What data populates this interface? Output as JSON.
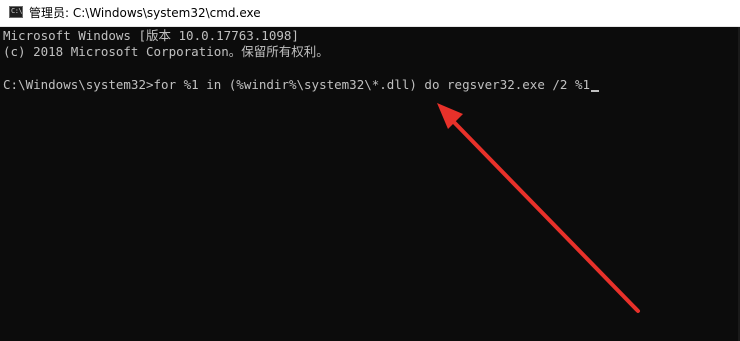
{
  "window": {
    "title": "管理员: C:\\Windows\\system32\\cmd.exe",
    "icon": "console-icon",
    "icon_glyph": "C:\\"
  },
  "console": {
    "lines": [
      "Microsoft Windows [版本 10.0.17763.1098]",
      "(c) 2018 Microsoft Corporation。保留所有权利。",
      "C:\\Windows\\system32>for %1 in (%windir%\\system32\\*.dll) do regsver32.exe /2 %1"
    ],
    "background_color": "#0c0c0c",
    "text_color": "#c0c0c0"
  },
  "annotation": {
    "arrow_color": "#e8312a",
    "icon": "red-arrow"
  }
}
